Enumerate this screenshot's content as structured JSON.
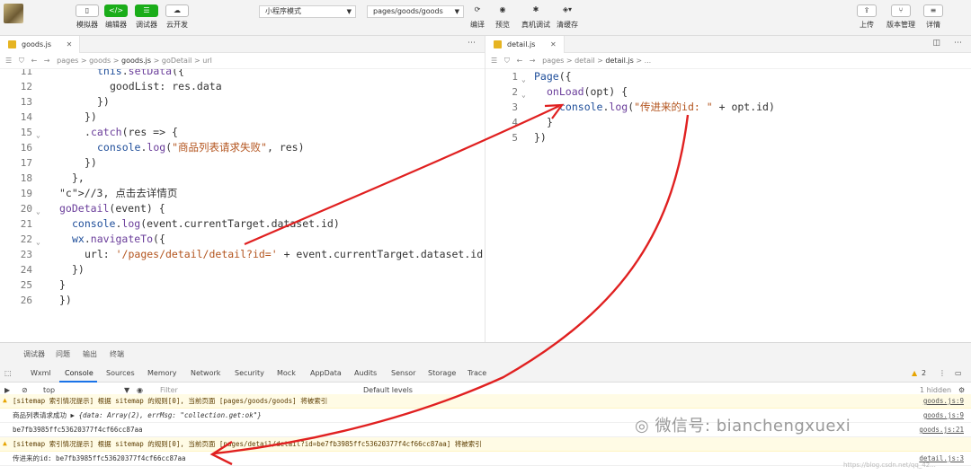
{
  "toolbar": {
    "left_buttons": [
      {
        "label": "模拟器",
        "icon": "phone-icon"
      },
      {
        "label": "编辑器",
        "icon": "code-icon"
      },
      {
        "label": "调试器",
        "icon": "debug-icon"
      },
      {
        "label": "云开发",
        "icon": "cloud-icon"
      }
    ],
    "mode_select": "小程序模式",
    "page_select": "pages/goods/goods",
    "mid_buttons": [
      {
        "label": "编译",
        "icon": "refresh-icon"
      },
      {
        "label": "预览",
        "icon": "eye-icon"
      },
      {
        "label": "真机调试",
        "icon": "bug-icon"
      },
      {
        "label": "清缓存",
        "icon": "layers-icon"
      }
    ],
    "right_buttons": [
      {
        "label": "上传",
        "icon": "upload-icon"
      },
      {
        "label": "版本管理",
        "icon": "branch-icon"
      },
      {
        "label": "详情",
        "icon": "menu-icon"
      }
    ]
  },
  "left_editor": {
    "tab": "goods.js",
    "breadcrumb": [
      "pages",
      "goods",
      "goods.js",
      "goDetail",
      "url"
    ],
    "lines": [
      {
        "n": "11",
        "code": "this.setData({"
      },
      {
        "n": "12",
        "code": "goodList: res.data"
      },
      {
        "n": "13",
        "code": "})"
      },
      {
        "n": "14",
        "code": "})"
      },
      {
        "n": "15",
        "code": ".catch(res => {"
      },
      {
        "n": "16",
        "code": "console.log(\"商品列表请求失败\", res)"
      },
      {
        "n": "17",
        "code": "})"
      },
      {
        "n": "18",
        "code": "},"
      },
      {
        "n": "19",
        "code": "//3, 点击去详情页"
      },
      {
        "n": "20",
        "code": "goDetail(event) {"
      },
      {
        "n": "21",
        "code": "console.log(event.currentTarget.dataset.id)"
      },
      {
        "n": "22",
        "code": "wx.navigateTo({"
      },
      {
        "n": "23",
        "code": "url: '/pages/detail/detail?id=' + event.currentTarget.dataset.id"
      },
      {
        "n": "24",
        "code": "})"
      },
      {
        "n": "25",
        "code": "}"
      },
      {
        "n": "26",
        "code": "})"
      }
    ]
  },
  "right_editor": {
    "tab": "detail.js",
    "breadcrumb": [
      "pages",
      "detail",
      "detail.js",
      "..."
    ],
    "lines": [
      {
        "n": "1",
        "code": "Page({"
      },
      {
        "n": "2",
        "code": "onLoad(opt) {"
      },
      {
        "n": "3",
        "code": "console.log(\"传进来的id: \" + opt.id)"
      },
      {
        "n": "4",
        "code": "}"
      },
      {
        "n": "5",
        "code": "})"
      }
    ]
  },
  "panel": {
    "top_tabs": [
      "调试器",
      "问题",
      "输出",
      "终端"
    ],
    "devtools_tabs": [
      "Wxml",
      "Console",
      "Sources",
      "Memory",
      "Network",
      "Security",
      "Mock",
      "AppData",
      "Audits",
      "Sensor",
      "Storage",
      "Trace"
    ],
    "active_tab": "Console",
    "warn_count": "2",
    "context": "top",
    "filter_placeholder": "Filter",
    "levels": "Default levels",
    "hidden": "1 hidden",
    "logs": [
      {
        "type": "warn",
        "text": "[sitemap 索引情况提示] 根据 sitemap 的规则[0], 当前页面 [pages/goods/goods] 将被索引",
        "src": "goods.js:9"
      },
      {
        "type": "log",
        "text": "商品列表请求成功",
        "obj": "{data: Array(2), errMsg: \"collection.get:ok\"}",
        "src": "goods.js:9"
      },
      {
        "type": "log",
        "text": "be7fb3985ffc53620377f4cf66cc87aa",
        "src": "goods.js:21"
      },
      {
        "type": "warn",
        "text": "[sitemap 索引情况提示] 根据 sitemap 的规则[0], 当前页面 [pages/detail/detail?id=be7fb3985ffc53620377f4cf66cc87aa] 将被索引",
        "src": ""
      },
      {
        "type": "log",
        "text": "传进来的id: be7fb3985ffc53620377f4cf66cc87aa",
        "src": "detail.js:3"
      }
    ]
  },
  "watermark": "微信号: bianchengxuexi",
  "watermark_url": "https://blog.csdn.net/qq_42..."
}
